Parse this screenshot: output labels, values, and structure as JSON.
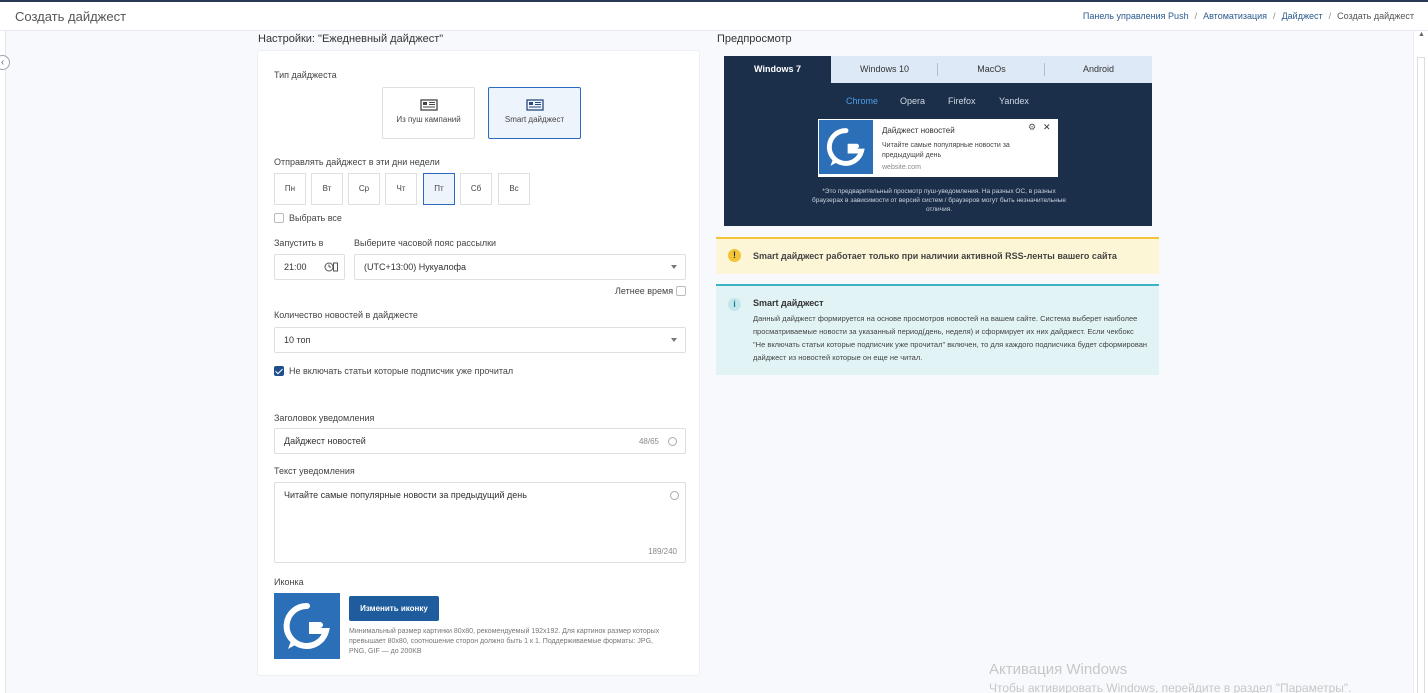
{
  "header": {
    "title": "Создать дайджест",
    "breadcrumbs": [
      "Панель управления Push",
      "Автоматизация",
      "Дайджест",
      "Создать дайджест"
    ]
  },
  "settings": {
    "title": "Настройки: \"Ежедневный дайджест\"",
    "digest_type_label": "Тип дайджеста",
    "digest_types": [
      {
        "label": "Из пуш кампаний",
        "selected": false
      },
      {
        "label": "Smart дайджест",
        "selected": true
      }
    ],
    "days_label": "Отправлять дайджест в эти дни недели",
    "days": [
      {
        "label": "Пн",
        "selected": false
      },
      {
        "label": "Вт",
        "selected": false
      },
      {
        "label": "Ср",
        "selected": false
      },
      {
        "label": "Чт",
        "selected": false
      },
      {
        "label": "Пт",
        "selected": true
      },
      {
        "label": "Сб",
        "selected": false
      },
      {
        "label": "Вс",
        "selected": false
      }
    ],
    "select_all_label": "Выбрать все",
    "start_label": "Запустить в",
    "start_time": "21:00",
    "timezone_label": "Выберите часовой пояс рассылки",
    "timezone_value": "(UTC+13:00) Нукуалофа",
    "summer_time_label": "Летнее время",
    "count_label": "Количество новостей в дайджесте",
    "count_value": "10 топ",
    "exclude_read_label": "Не включать статьи которые подписчик уже прочитал",
    "notif_title_label": "Заголовок уведомления",
    "notif_title_value": "Дайджест новостей",
    "notif_title_counter": "48/65",
    "notif_text_label": "Текст уведомления",
    "notif_text_value": "Читайте самые популярные новости за предыдущий день",
    "notif_text_counter": "189/240",
    "icon_label": "Иконка",
    "change_icon_button": "Изменить иконку",
    "icon_hint": "Минимальный размер картинки 80х80, рекомендуемый 192х192. Для картинок размер которых превышает 80х80, соотношение сторон должно быть 1 к 1. Поддерживаемые форматы: JPG, PNG, GIF — до 200KB"
  },
  "preview": {
    "title": "Предпросмотр",
    "os_tabs": [
      "Windows 7",
      "Windows 10",
      "MacOs",
      "Android"
    ],
    "browsers": [
      "Chrome",
      "Opera",
      "Firefox",
      "Yandex"
    ],
    "notification": {
      "title": "Дайджест новостей",
      "body": "Читайте самые популярные новости за предыдущий день",
      "site": "website.com"
    },
    "note": "*Это предварительный просмотр пуш-уведомления. На разных ОС, в разных браузерах в зависимости от версий систем / браузеров могут быть незначительные отличия."
  },
  "alerts": {
    "warning": "Smart дайджест работает только при наличии активной RSS-ленты вашего сайта",
    "info_title": "Smart дайджест",
    "info_body": "Данный дайджест формируется на основе просмотров новостей на вашем сайте. Система выберет наиболее просматриваемые новости за указанный период(день, неделя) и сформирует их них дайджест. Если чекбокс \"Не включать статьи которые подписчик уже прочитал\" включен, то для каждого подписчика будет сформирован дайджест из новостей которые он еще не читал."
  },
  "watermark": {
    "line1": "Активация Windows",
    "line2": "Чтобы активировать Windows, перейдите в раздел \"Параметры\"."
  },
  "colors": {
    "accent": "#1f5c9e",
    "preview_bg": "#1c2f4a",
    "warning": "#f3c437",
    "info": "#3ab4c2"
  }
}
